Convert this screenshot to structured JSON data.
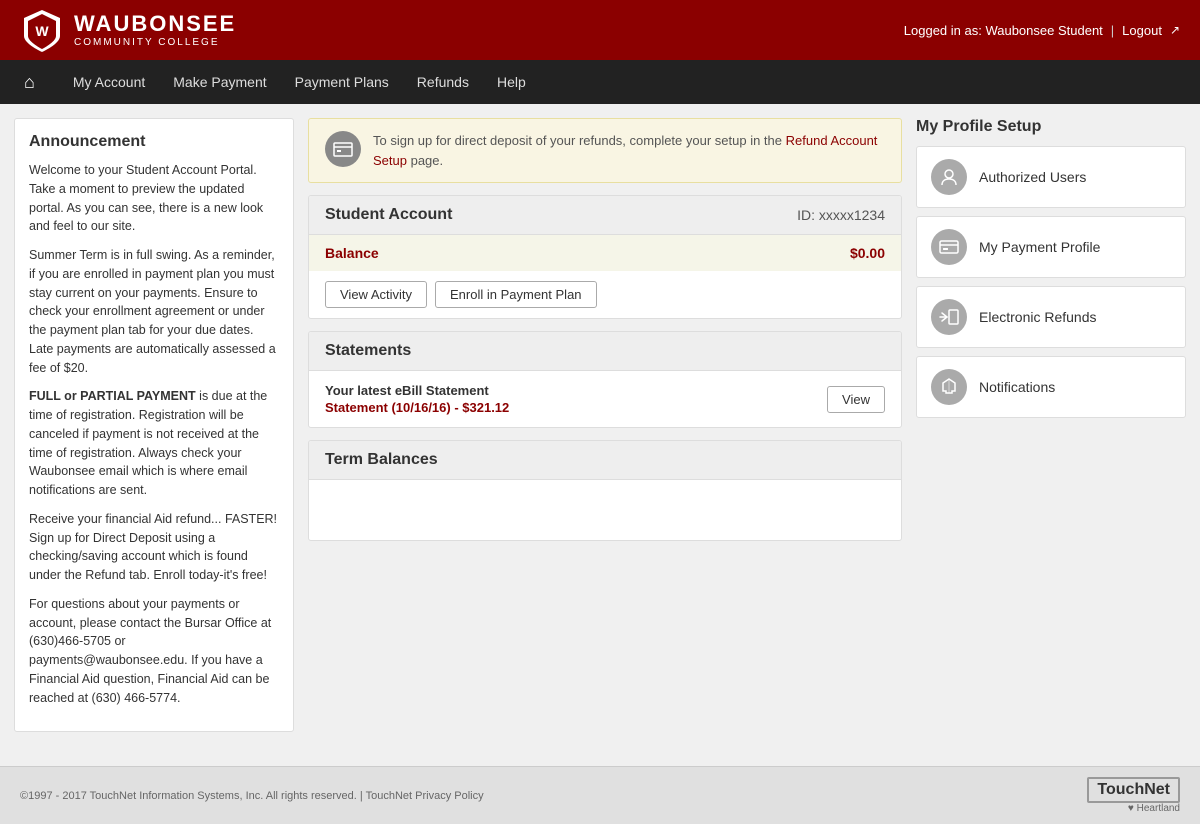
{
  "header": {
    "college_name": "WAUBONSEE",
    "college_subtitle": "COMMUNITY COLLEGE",
    "logged_in_text": "Logged in as: Waubonsee Student",
    "logout_label": "Logout"
  },
  "nav": {
    "home_title": "Home",
    "items": [
      {
        "label": "My Account",
        "href": "#"
      },
      {
        "label": "Make Payment",
        "href": "#"
      },
      {
        "label": "Payment Plans",
        "href": "#"
      },
      {
        "label": "Refunds",
        "href": "#"
      },
      {
        "label": "Help",
        "href": "#"
      }
    ]
  },
  "announcement": {
    "title": "Announcement",
    "paragraphs": [
      "Welcome to your Student Account Portal. Take a moment to preview the updated portal. As you can see, there is a new look and feel to our site.",
      "Summer Term is in full swing. As a reminder, if you are enrolled in payment plan you must stay current on your payments. Ensure to check your enrollment agreement or under the payment plan tab for your due dates. Late payments are automatically assessed a fee of $20.",
      "FULL or PARTIAL PAYMENT is due at the time of registration. Registration will be canceled if payment is not received at the time of registration. Always check your Waubonsee email which is where email notifications are sent.",
      "Receive your financial Aid refund... FASTER! Sign up for Direct Deposit using a checking/saving account which is found under the Refund tab. Enroll today-it's free!",
      "For questions about your payments or account, please contact the Bursar Office at (630)466-5705 or payments@waubonsee.edu. If you have a Financial Aid question, Financial Aid can be reached at (630) 466-5774."
    ],
    "bold_phrase": "FULL or PARTIAL PAYMENT"
  },
  "notice": {
    "text_before_link": "To sign up for direct deposit of your refunds, complete your setup in the ",
    "link_text": "Refund Account Setup",
    "text_after_link": " page."
  },
  "student_account": {
    "title": "Student Account",
    "id_label": "ID: xxxxx1234",
    "balance_label": "Balance",
    "balance_amount": "$0.00",
    "view_activity_btn": "View Activity",
    "enroll_btn": "Enroll in Payment Plan"
  },
  "statements": {
    "title": "Statements",
    "latest_label": "Your latest eBill Statement",
    "statement_link": "Statement (10/16/16) - $321.12",
    "view_btn": "View"
  },
  "term_balances": {
    "title": "Term Balances"
  },
  "profile_setup": {
    "title": "My Profile Setup",
    "items": [
      {
        "label": "Authorized Users",
        "icon": "👤"
      },
      {
        "label": "My Payment Profile",
        "icon": "💳"
      },
      {
        "label": "Electronic Refunds",
        "icon": "↩"
      },
      {
        "label": "Notifications",
        "icon": "🚩"
      }
    ]
  },
  "footer": {
    "copyright": "©1997 - 2017  TouchNet Information Systems, Inc. All rights reserved. | TouchNet Privacy Policy",
    "brand_name": "TouchNet",
    "brand_sub": "♥ Heartland"
  }
}
